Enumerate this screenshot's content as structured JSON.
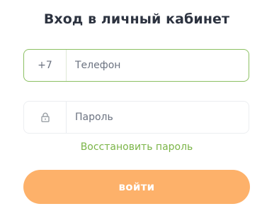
{
  "title": "Вход в личный кабинет",
  "phone": {
    "prefix": "+7",
    "placeholder": "Телефон",
    "value": ""
  },
  "password": {
    "icon": "lock-icon",
    "placeholder": "Пароль",
    "value": ""
  },
  "restore_link": "Восстановить пароль",
  "submit_label": "войти",
  "colors": {
    "accent_green": "#7bb548",
    "focus_border": "#8cc063",
    "button": "#fdb16a",
    "title": "#2d3340"
  }
}
